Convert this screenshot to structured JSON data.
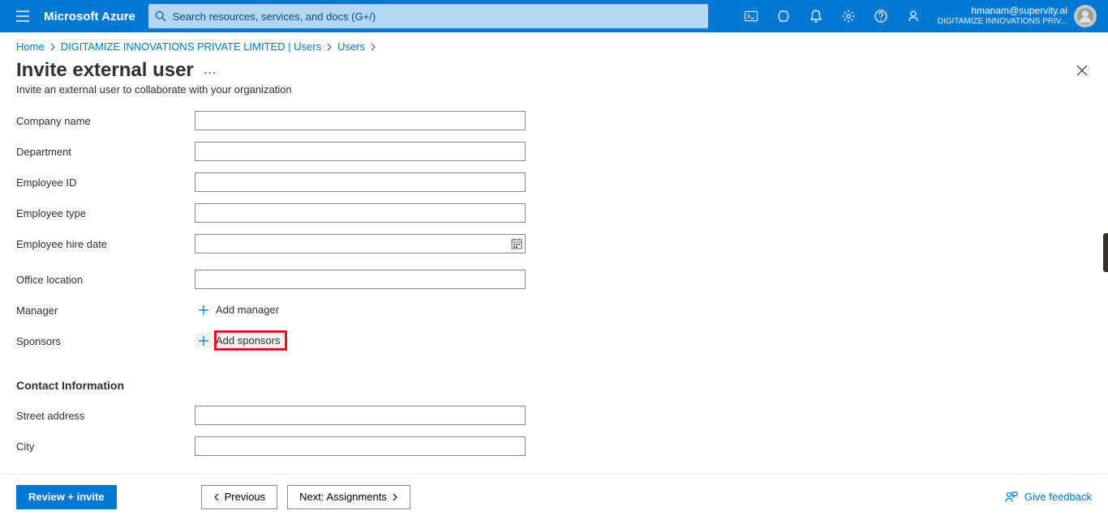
{
  "topbar": {
    "brand": "Microsoft Azure",
    "search_placeholder": "Search resources, services, and docs (G+/)"
  },
  "account": {
    "email": "hmanam@supervity.ai",
    "org": "DIGITAMIZE INNOVATIONS PRIV..."
  },
  "breadcrumb": {
    "home": "Home",
    "org_users": "DIGITAMIZE INNOVATIONS PRIVATE LIMITED | Users",
    "users": "Users"
  },
  "page": {
    "title": "Invite external user",
    "subtitle": "Invite an external user to collaborate with your organization"
  },
  "form": {
    "company_name": {
      "label": "Company name",
      "value": ""
    },
    "department": {
      "label": "Department",
      "value": ""
    },
    "employee_id": {
      "label": "Employee ID",
      "value": ""
    },
    "employee_type": {
      "label": "Employee type",
      "value": ""
    },
    "employee_hire_date": {
      "label": "Employee hire date",
      "value": ""
    },
    "office_location": {
      "label": "Office location",
      "value": ""
    },
    "manager": {
      "label": "Manager",
      "add_label": "Add manager"
    },
    "sponsors": {
      "label": "Sponsors",
      "add_label": "Add sponsors"
    },
    "contact_section": "Contact Information",
    "street_address": {
      "label": "Street address",
      "value": ""
    },
    "city": {
      "label": "City",
      "value": ""
    }
  },
  "footer": {
    "review_invite": "Review + invite",
    "previous": "Previous",
    "next": "Next: Assignments",
    "feedback": "Give feedback"
  }
}
